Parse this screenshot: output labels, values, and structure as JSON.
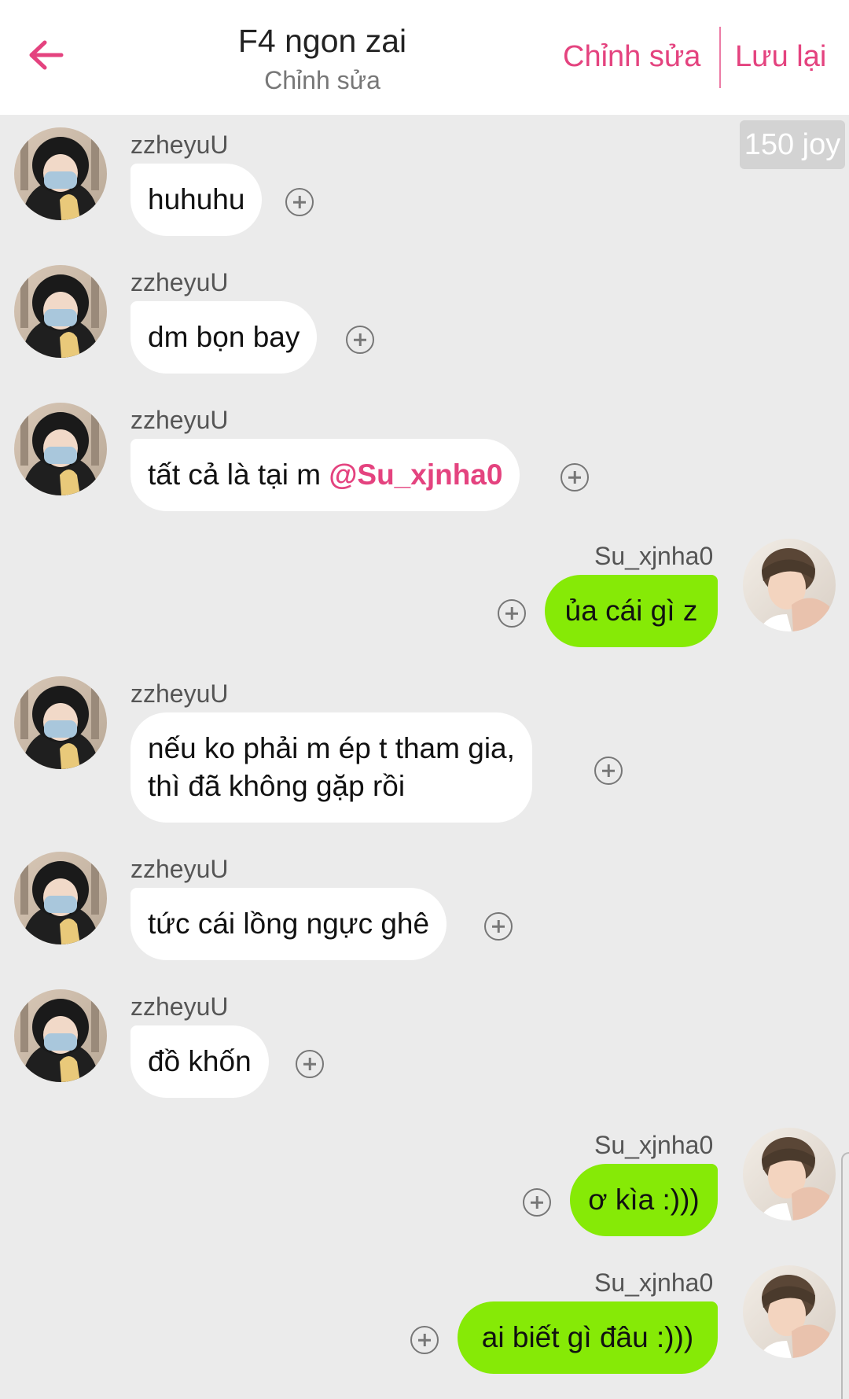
{
  "header": {
    "title": "F4 ngon zai",
    "subtitle": "Chỉnh sửa",
    "edit_label": "Chỉnh sửa",
    "save_label": "Lưu lại"
  },
  "joy_badge": "150 joy",
  "messages": [
    {
      "sender": "zzheyuU",
      "text": "huhuhu"
    },
    {
      "sender": "zzheyuU",
      "text": "dm bọn bay"
    },
    {
      "sender": "zzheyuU",
      "text": "tất cả là tại m ",
      "mention": "@Su_xjnha0"
    },
    {
      "sender": "Su_xjnha0",
      "text": "ủa cái gì z"
    },
    {
      "sender": "zzheyuU",
      "text_line1": "nếu ko phải m ép t tham gia,",
      "text_line2": "thì đã không gặp rồi"
    },
    {
      "sender": "zzheyuU",
      "text": "tức cái lồng ngực ghê"
    },
    {
      "sender": "zzheyuU",
      "text": "đồ khốn"
    },
    {
      "sender": "Su_xjnha0",
      "text": "ơ kìa :)))"
    },
    {
      "sender": "Su_xjnha0",
      "text": "ai biết gì đâu :)))"
    }
  ],
  "colors": {
    "accent": "#e4437f",
    "my_bubble": "#86ea06",
    "other_bubble": "#ffffff",
    "background": "#ebebeb"
  },
  "icons": {
    "back": "arrow-left-icon",
    "react": "plus-circle-icon"
  }
}
